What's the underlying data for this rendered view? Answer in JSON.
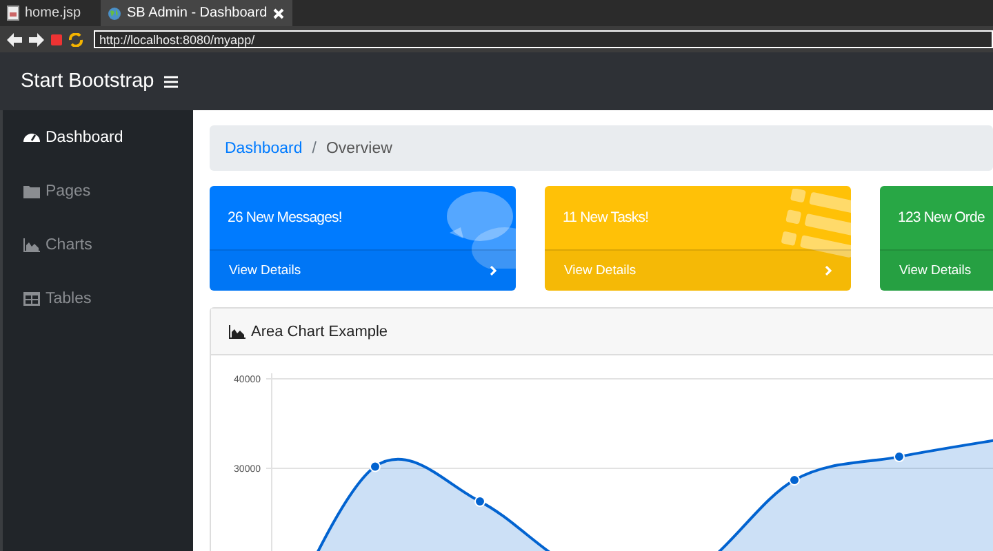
{
  "browser": {
    "tabs": [
      {
        "label": "home.jsp",
        "selected": false
      },
      {
        "label": "SB Admin - Dashboard",
        "selected": true
      }
    ],
    "address": "http://localhost:8080/myapp/"
  },
  "navbar": {
    "brand": "Start Bootstrap"
  },
  "sidebar": {
    "items": [
      {
        "label": "Dashboard",
        "selected": true
      },
      {
        "label": "Pages",
        "selected": false
      },
      {
        "label": "Charts",
        "selected": false
      },
      {
        "label": "Tables",
        "selected": false
      }
    ]
  },
  "breadcrumb": {
    "items": [
      "Dashboard",
      "Overview"
    ],
    "separator": "/"
  },
  "cards": [
    {
      "title": "26 New Messages!",
      "link": "View Details",
      "color": "#007bff"
    },
    {
      "title": "11 New Tasks!",
      "link": "View Details",
      "color": "#ffc107"
    },
    {
      "title": "123 New Orde",
      "link": "View Details",
      "color": "#28a745"
    }
  ],
  "chart_card": {
    "title": "Area Chart Example",
    "chart_data": {
      "type": "area",
      "series": [
        {
          "color": "#0263d0",
          "values": [
            10000,
            30200,
            26300,
            18400,
            18300,
            28700,
            31300,
            33300
          ]
        }
      ],
      "ylim": [
        0,
        40000
      ],
      "yticks": [
        30000,
        40000
      ]
    }
  }
}
